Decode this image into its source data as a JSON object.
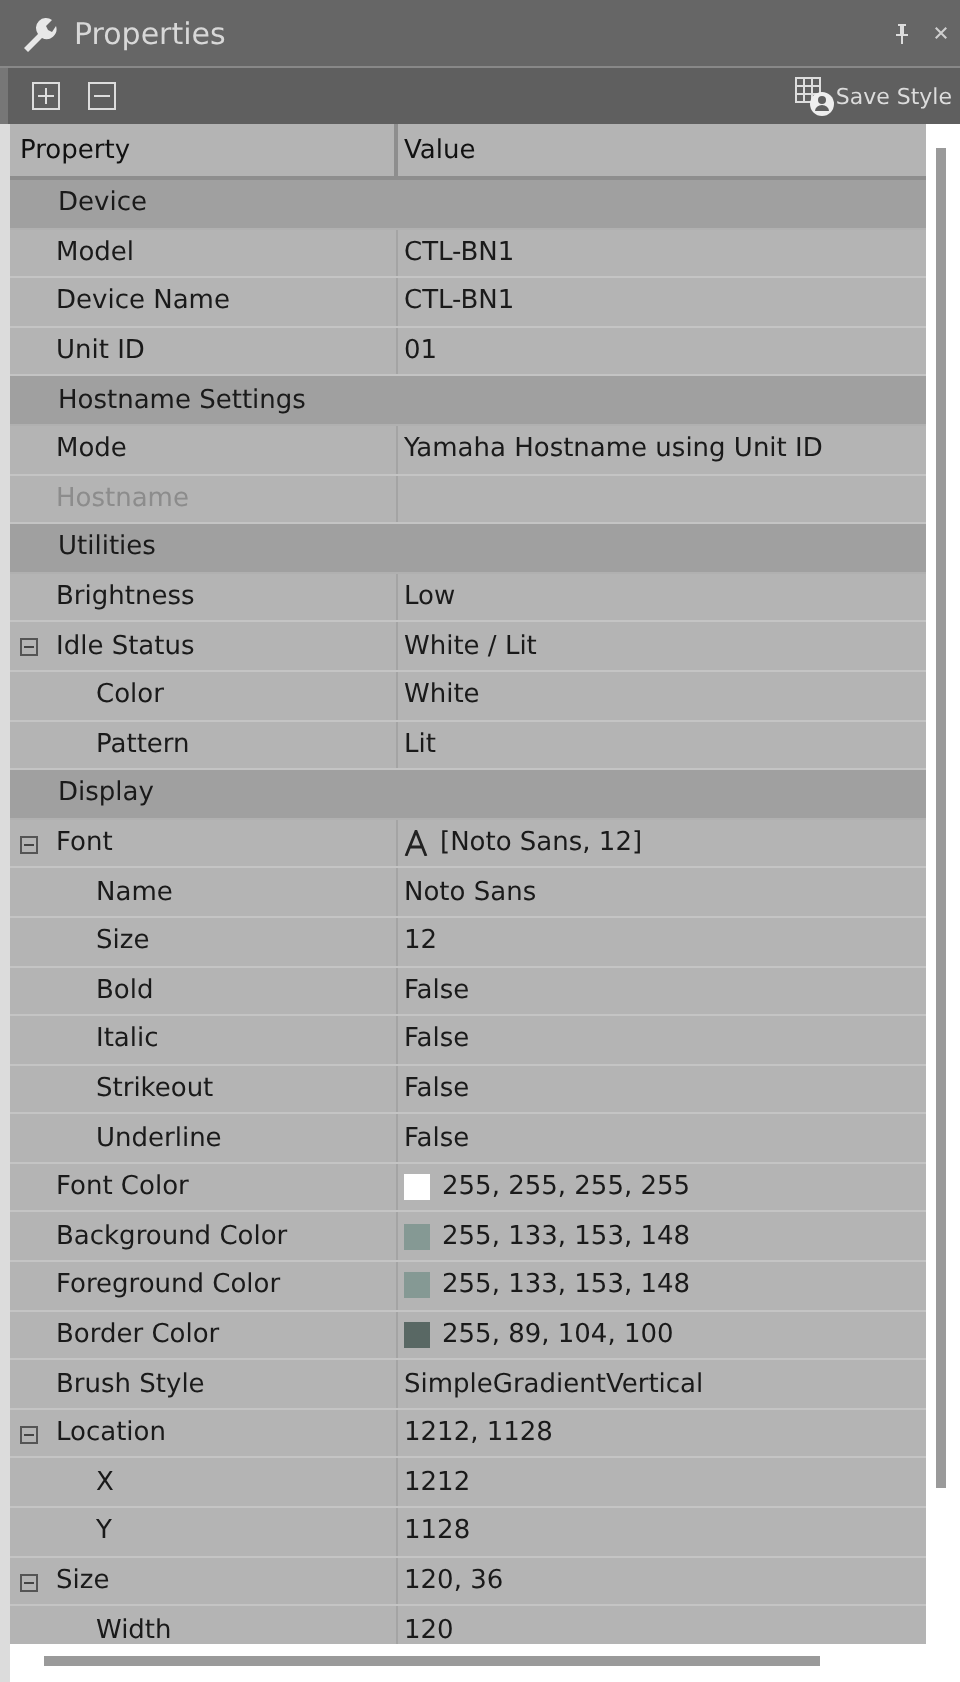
{
  "window": {
    "title": "Properties"
  },
  "toolbar": {
    "save_style": "Save Style"
  },
  "columns": [
    "Property",
    "Value"
  ],
  "rows": [
    {
      "kind": "category",
      "name": "Device",
      "children": [
        {
          "kind": "property",
          "name": "Model",
          "value": "CTL-BN1"
        },
        {
          "kind": "property",
          "name": "Device Name",
          "value": "CTL-BN1"
        },
        {
          "kind": "property",
          "name": "Unit ID",
          "value": "01"
        }
      ]
    },
    {
      "kind": "category",
      "name": "Hostname Settings",
      "children": [
        {
          "kind": "property",
          "name": "Mode",
          "value": "Yamaha Hostname using Unit ID"
        },
        {
          "kind": "property",
          "name": "Hostname",
          "disabled": true
        }
      ]
    },
    {
      "kind": "category",
      "name": "Utilities",
      "children": [
        {
          "kind": "property",
          "name": "Brightness",
          "value": "Low"
        },
        {
          "kind": "property",
          "name": "Idle Status",
          "value": "White / Lit",
          "expanded": true,
          "children": [
            {
              "kind": "property",
              "name": "Color",
              "value": "White"
            },
            {
              "kind": "property",
              "name": "Pattern",
              "value": "Lit"
            }
          ]
        }
      ]
    },
    {
      "kind": "category",
      "name": "Display",
      "children": [
        {
          "kind": "font",
          "name": "Font",
          "value": "[Noto Sans, 12]",
          "expanded": true,
          "children": [
            {
              "kind": "property",
              "name": "Name",
              "value": "Noto Sans"
            },
            {
              "kind": "property",
              "name": "Size",
              "value": "12"
            },
            {
              "kind": "property",
              "name": "Bold",
              "value": "False"
            },
            {
              "kind": "property",
              "name": "Italic",
              "value": "False"
            },
            {
              "kind": "property",
              "name": "Strikeout",
              "value": "False"
            },
            {
              "kind": "property",
              "name": "Underline",
              "value": "False"
            }
          ]
        },
        {
          "kind": "color",
          "name": "Font Color",
          "value": "255, 255, 255, 255",
          "color": "#ffffff"
        },
        {
          "kind": "color",
          "name": "Background Color",
          "value": "255, 133, 153, 148",
          "color": "#859994"
        },
        {
          "kind": "color",
          "name": "Foreground Color",
          "value": "255, 133, 153, 148",
          "color": "#859994"
        },
        {
          "kind": "color",
          "name": "Border Color",
          "value": "255, 89, 104, 100",
          "color": "#596864"
        },
        {
          "kind": "property",
          "name": "Brush Style",
          "value": "SimpleGradientVertical"
        },
        {
          "kind": "property",
          "name": "Location",
          "value": "1212, 1128",
          "expanded": true,
          "children": [
            {
              "kind": "property",
              "name": "X",
              "value": "1212"
            },
            {
              "kind": "property",
              "name": "Y",
              "value": "1128"
            }
          ]
        },
        {
          "kind": "property",
          "name": "Size",
          "value": "120, 36",
          "expanded": true,
          "children": [
            {
              "kind": "property",
              "name": "Width",
              "value": "120"
            }
          ]
        }
      ]
    }
  ]
}
